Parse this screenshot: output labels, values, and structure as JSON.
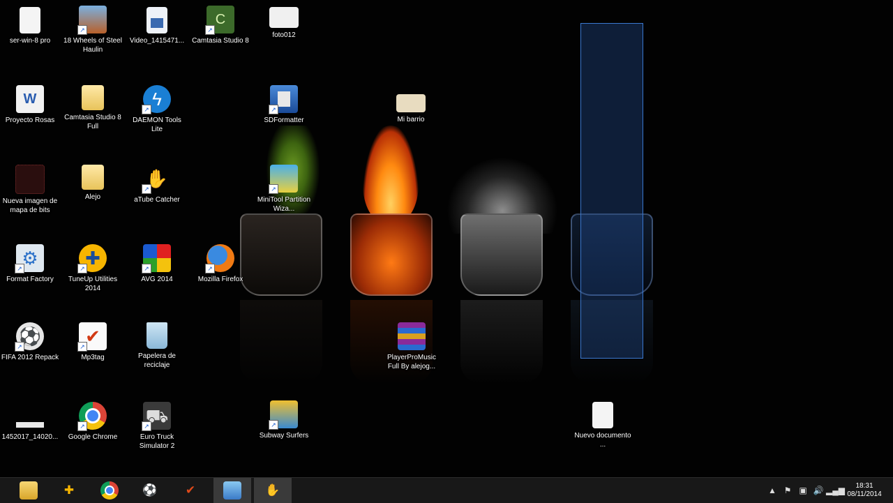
{
  "desktop": {
    "icons": [
      {
        "id": "ser-win",
        "label": "ser-win-8 pro",
        "icon": "document-icon"
      },
      {
        "id": "wheels",
        "label": "18 Wheels of Steel Haulin",
        "icon": "truck-game-icon"
      },
      {
        "id": "video",
        "label": "Video_1415471...",
        "icon": "video-file-icon"
      },
      {
        "id": "camtasia8",
        "label": "Camtasia Studio 8",
        "icon": "camtasia-icon"
      },
      {
        "id": "foto012",
        "label": "foto012",
        "icon": "image-file-icon"
      },
      {
        "id": "proyecto",
        "label": "Proyecto Rosas",
        "icon": "word-document-icon"
      },
      {
        "id": "camtasia-full",
        "label": "Camtasia Studio 8 Full",
        "icon": "folder-icon"
      },
      {
        "id": "daemon",
        "label": "DAEMON Tools Lite",
        "icon": "daemon-tools-icon"
      },
      {
        "id": "sdformatter",
        "label": "SDFormatter",
        "icon": "sd-formatter-icon"
      },
      {
        "id": "mibarrio",
        "label": "Mi barrio",
        "icon": "image-file-icon"
      },
      {
        "id": "bitmap",
        "label": "Nueva imagen de mapa de bits",
        "icon": "bitmap-icon"
      },
      {
        "id": "alejo",
        "label": "Alejo",
        "icon": "folder-icon"
      },
      {
        "id": "atube",
        "label": "aTube Catcher",
        "icon": "atube-catcher-icon"
      },
      {
        "id": "minitool",
        "label": "MiniTool Partition Wiza...",
        "icon": "partition-wizard-icon"
      },
      {
        "id": "formatfactory",
        "label": "Format Factory",
        "icon": "format-factory-icon"
      },
      {
        "id": "tuneup",
        "label": "TuneUp Utilities 2014",
        "icon": "tuneup-icon"
      },
      {
        "id": "avg",
        "label": "AVG 2014",
        "icon": "avg-icon"
      },
      {
        "id": "firefox",
        "label": "Mozilla Firefox",
        "icon": "firefox-icon"
      },
      {
        "id": "fifa",
        "label": "FIFA 2012 Repack",
        "icon": "fifa-icon"
      },
      {
        "id": "mp3tag",
        "label": "Mp3tag",
        "icon": "mp3tag-icon"
      },
      {
        "id": "papelera",
        "label": "Papelera de reciclaje",
        "icon": "recycle-bin-icon"
      },
      {
        "id": "playerpro",
        "label": "PlayerProMusic Full By alejog...",
        "icon": "winrar-archive-icon"
      },
      {
        "id": "file1452017",
        "label": "1452017_14020...",
        "icon": "image-file-icon"
      },
      {
        "id": "chrome",
        "label": "Google Chrome",
        "icon": "chrome-icon"
      },
      {
        "id": "eurotruck",
        "label": "Euro Truck Simulator 2",
        "icon": "euro-truck-icon"
      },
      {
        "id": "subway",
        "label": "Subway Surfers",
        "icon": "subway-surfers-icon"
      },
      {
        "id": "nuevodoc",
        "label": "Nuevo documento ...",
        "icon": "document-icon"
      }
    ]
  },
  "taskbar": {
    "items": [
      {
        "id": "file-explorer",
        "icon": "file-explorer-icon",
        "active": false
      },
      {
        "id": "tuneup",
        "icon": "tuneup-icon",
        "active": false
      },
      {
        "id": "chrome",
        "icon": "chrome-icon",
        "active": false
      },
      {
        "id": "fifa",
        "icon": "fifa-icon",
        "active": false
      },
      {
        "id": "mp3tag",
        "icon": "mp3tag-icon",
        "active": false
      },
      {
        "id": "minitool",
        "icon": "partition-wizard-icon",
        "active": true
      },
      {
        "id": "atube",
        "icon": "atube-catcher-icon",
        "active": true
      }
    ],
    "tray": {
      "icons": [
        "show-hidden-icons-icon",
        "action-center-flag-icon",
        "network-drive-icon",
        "volume-icon",
        "signal-icon"
      ],
      "time": "18:31",
      "date": "08/11/2014"
    }
  },
  "colors": {
    "selection_fill": "#285aaa",
    "selection_border": "#3a78d0",
    "taskbar_bg": "#181818"
  }
}
